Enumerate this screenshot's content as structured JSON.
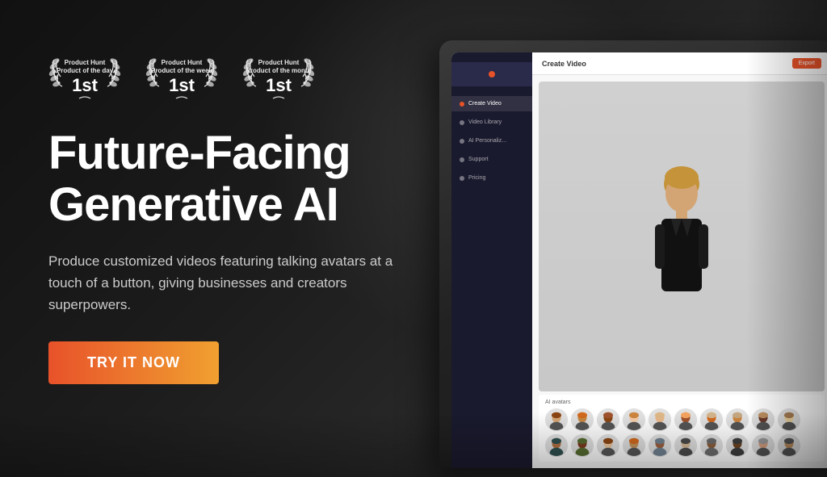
{
  "hero": {
    "badges": [
      {
        "line1": "Product Hunt",
        "line2": "Product of the day",
        "rank": "1st"
      },
      {
        "line1": "Product Hunt",
        "line2": "Product of the week",
        "rank": "1st"
      },
      {
        "line1": "Product Hunt",
        "line2": "Product of the month",
        "rank": "1st"
      }
    ],
    "headline_line1": "Future-Facing",
    "headline_line2": "Generative AI",
    "subtitle": "Produce customized videos featuring talking avatars at a touch of a button, giving businesses and creators superpowers.",
    "cta_label": "TRY IT NOW"
  },
  "app_ui": {
    "header_title": "Create Video",
    "header_btn": "Export",
    "sidebar_items": [
      {
        "label": "Create Video",
        "active": true
      },
      {
        "label": "Video Library",
        "active": false
      },
      {
        "label": "AI Personalization",
        "active": false
      },
      {
        "label": "Support",
        "active": false
      },
      {
        "label": "Pricing",
        "active": false
      }
    ],
    "avatars_label": "AI avatars",
    "avatar_colors": [
      "#8B4513",
      "#D2691E",
      "#A0522D",
      "#CD853F",
      "#DEB887",
      "#F4A460",
      "#D2B48C",
      "#C4A882",
      "#BC8F5F",
      "#A67C52",
      "#2F4F4F",
      "#556B2F",
      "#8B4513",
      "#D2691E",
      "#708090",
      "#4A4A4A",
      "#6B6B6B",
      "#3D3D3D",
      "#9B9B9B",
      "#555555"
    ]
  },
  "colors": {
    "cta_gradient_start": "#e8522a",
    "cta_gradient_end": "#f0a030",
    "background": "#1a1a1a",
    "text_primary": "#ffffff",
    "text_secondary": "#cccccc"
  }
}
